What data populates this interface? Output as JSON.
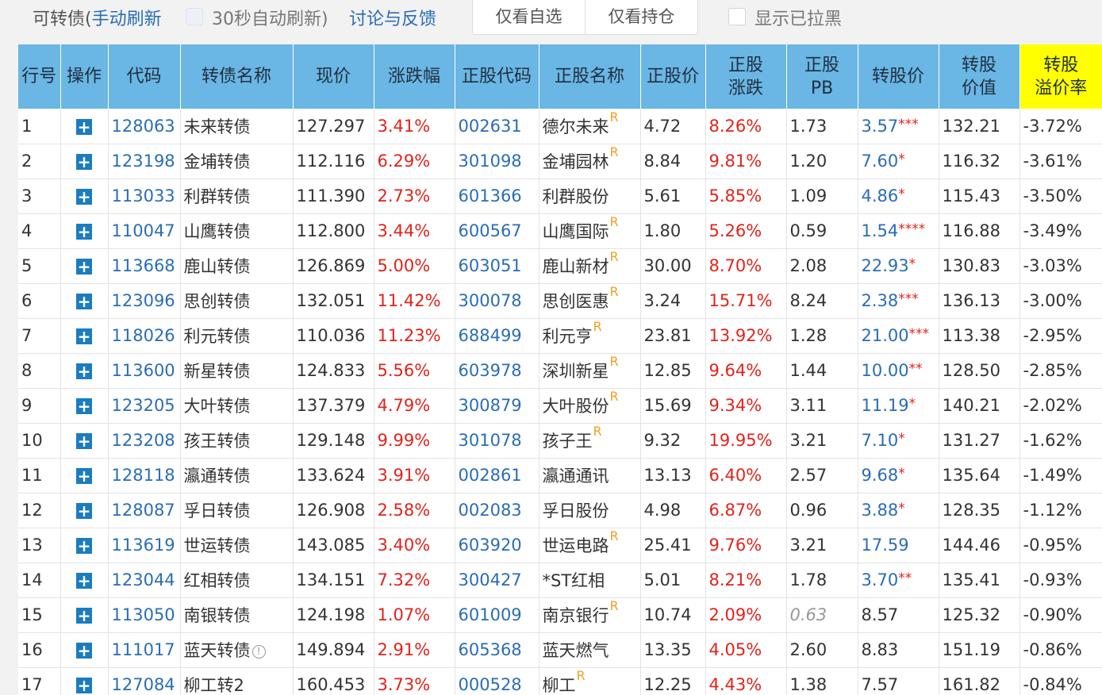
{
  "toolbar": {
    "title_prefix": "可转债(",
    "manual_refresh": "手动刷新",
    "auto_refresh": "30秒自动刷新)",
    "feedback": "讨论与反馈",
    "watchlist_button": "仅看自选",
    "holdings_button": "仅看持仓",
    "show_blacklist": "显示已拉黑"
  },
  "table": {
    "headers": {
      "row_no": "行号",
      "op": "操作",
      "code": "代码",
      "name": "转债名称",
      "price": "现价",
      "change": "涨跌幅",
      "stock_code": "正股代码",
      "stock_name": "正股名称",
      "stock_price": "正股价",
      "stock_change_1": "正股",
      "stock_change_2": "涨跌",
      "pb_1": "正股",
      "pb_2": "PB",
      "conv_price": "转股价",
      "conv_value_1": "转股",
      "conv_value_2": "价值",
      "premium_1": "转股",
      "premium_2": "溢价率"
    },
    "plus_glyph": "+",
    "r_mark": "R",
    "info_glyph": "!",
    "rows": [
      {
        "no": "1",
        "code": "128063",
        "name": "未来转债",
        "price": "127.297",
        "change": "3.41%",
        "stock_code": "002631",
        "stock_name": "德尔未来",
        "r": true,
        "stock_price": "4.72",
        "stock_change": "8.26%",
        "pb": "1.73",
        "conv_price": "3.57",
        "stars": "***",
        "conv_value": "132.21",
        "premium": "-3.72%"
      },
      {
        "no": "2",
        "code": "123198",
        "name": "金埔转债",
        "price": "112.116",
        "change": "6.29%",
        "stock_code": "301098",
        "stock_name": "金埔园林",
        "r": true,
        "stock_price": "8.84",
        "stock_change": "9.81%",
        "pb": "1.20",
        "conv_price": "7.60",
        "stars": "*",
        "conv_value": "116.32",
        "premium": "-3.61%"
      },
      {
        "no": "3",
        "code": "113033",
        "name": "利群转债",
        "price": "111.390",
        "change": "2.73%",
        "stock_code": "601366",
        "stock_name": "利群股份",
        "r": false,
        "stock_price": "5.61",
        "stock_change": "5.85%",
        "pb": "1.09",
        "conv_price": "4.86",
        "stars": "*",
        "conv_value": "115.43",
        "premium": "-3.50%"
      },
      {
        "no": "4",
        "code": "110047",
        "name": "山鹰转债",
        "price": "112.800",
        "change": "3.44%",
        "stock_code": "600567",
        "stock_name": "山鹰国际",
        "r": true,
        "stock_price": "1.80",
        "stock_change": "5.26%",
        "pb": "0.59",
        "conv_price": "1.54",
        "stars": "****",
        "conv_value": "116.88",
        "premium": "-3.49%"
      },
      {
        "no": "5",
        "code": "113668",
        "name": "鹿山转债",
        "price": "126.869",
        "change": "5.00%",
        "stock_code": "603051",
        "stock_name": "鹿山新材",
        "r": true,
        "stock_price": "30.00",
        "stock_change": "8.70%",
        "pb": "2.08",
        "conv_price": "22.93",
        "stars": "*",
        "conv_value": "130.83",
        "premium": "-3.03%"
      },
      {
        "no": "6",
        "code": "123096",
        "name": "思创转债",
        "price": "132.051",
        "change": "11.42%",
        "stock_code": "300078",
        "stock_name": "思创医惠",
        "r": true,
        "stock_price": "3.24",
        "stock_change": "15.71%",
        "pb": "8.24",
        "conv_price": "2.38",
        "stars": "***",
        "conv_value": "136.13",
        "premium": "-3.00%"
      },
      {
        "no": "7",
        "code": "118026",
        "name": "利元转债",
        "price": "110.036",
        "change": "11.23%",
        "stock_code": "688499",
        "stock_name": "利元亨",
        "r": true,
        "stock_price": "23.81",
        "stock_change": "13.92%",
        "pb": "1.28",
        "conv_price": "21.00",
        "stars": "***",
        "conv_value": "113.38",
        "premium": "-2.95%"
      },
      {
        "no": "8",
        "code": "113600",
        "name": "新星转债",
        "price": "124.833",
        "change": "5.56%",
        "stock_code": "603978",
        "stock_name": "深圳新星",
        "r": true,
        "stock_price": "12.85",
        "stock_change": "9.64%",
        "pb": "1.44",
        "conv_price": "10.00",
        "stars": "**",
        "conv_value": "128.50",
        "premium": "-2.85%"
      },
      {
        "no": "9",
        "code": "123205",
        "name": "大叶转债",
        "price": "137.379",
        "change": "4.79%",
        "stock_code": "300879",
        "stock_name": "大叶股份",
        "r": true,
        "stock_price": "15.69",
        "stock_change": "9.34%",
        "pb": "3.11",
        "conv_price": "11.19",
        "stars": "*",
        "conv_value": "140.21",
        "premium": "-2.02%"
      },
      {
        "no": "10",
        "code": "123208",
        "name": "孩王转债",
        "price": "129.148",
        "change": "9.99%",
        "stock_code": "301078",
        "stock_name": "孩子王",
        "r": true,
        "stock_price": "9.32",
        "stock_change": "19.95%",
        "pb": "3.21",
        "conv_price": "7.10",
        "stars": "*",
        "conv_value": "131.27",
        "premium": "-1.62%"
      },
      {
        "no": "11",
        "code": "128118",
        "name": "瀛通转债",
        "price": "133.624",
        "change": "3.91%",
        "stock_code": "002861",
        "stock_name": "瀛通通讯",
        "r": false,
        "stock_price": "13.13",
        "stock_change": "6.40%",
        "pb": "2.57",
        "conv_price": "9.68",
        "stars": "*",
        "conv_value": "135.64",
        "premium": "-1.49%"
      },
      {
        "no": "12",
        "code": "128087",
        "name": "孚日转债",
        "price": "126.908",
        "change": "2.58%",
        "stock_code": "002083",
        "stock_name": "孚日股份",
        "r": false,
        "stock_price": "4.98",
        "stock_change": "6.87%",
        "pb": "0.96",
        "conv_price": "3.88",
        "stars": "*",
        "conv_value": "128.35",
        "premium": "-1.12%"
      },
      {
        "no": "13",
        "code": "113619",
        "name": "世运转债",
        "price": "143.085",
        "change": "3.40%",
        "stock_code": "603920",
        "stock_name": "世运电路",
        "r": true,
        "stock_price": "25.41",
        "stock_change": "9.76%",
        "pb": "3.21",
        "conv_price": "17.59",
        "stars": "",
        "conv_value": "144.46",
        "premium": "-0.95%"
      },
      {
        "no": "14",
        "code": "123044",
        "name": "红相转债",
        "price": "134.151",
        "change": "7.32%",
        "stock_code": "300427",
        "stock_name": "*ST红相",
        "r": false,
        "stock_price": "5.01",
        "stock_change": "8.21%",
        "pb": "1.78",
        "conv_price": "3.70",
        "stars": "**",
        "conv_value": "135.41",
        "premium": "-0.93%"
      },
      {
        "no": "15",
        "code": "113050",
        "name": "南银转债",
        "price": "124.198",
        "change": "1.07%",
        "stock_code": "601009",
        "stock_name": "南京银行",
        "r": true,
        "stock_price": "10.74",
        "stock_change": "2.09%",
        "pb": "0.63",
        "pb_gray": true,
        "conv_price": "8.57",
        "conv_plain": true,
        "stars": "",
        "conv_value": "125.32",
        "premium": "-0.90%"
      },
      {
        "no": "16",
        "code": "111017",
        "name": "蓝天转债",
        "info": true,
        "price": "149.894",
        "change": "2.91%",
        "stock_code": "605368",
        "stock_name": "蓝天燃气",
        "r": false,
        "stock_price": "13.35",
        "stock_change": "4.05%",
        "pb": "2.60",
        "conv_price": "8.83",
        "conv_plain": true,
        "stars": "",
        "conv_value": "151.19",
        "premium": "-0.86%"
      },
      {
        "no": "17",
        "code": "127084",
        "name": "柳工转2",
        "price": "160.453",
        "change": "3.73%",
        "stock_code": "000528",
        "stock_name": "柳工",
        "r": true,
        "stock_price": "12.25",
        "stock_change": "4.43%",
        "pb": "1.38",
        "conv_price": "7.57",
        "conv_plain": true,
        "stars": "",
        "conv_value": "161.82",
        "premium": "-0.84%"
      }
    ]
  }
}
